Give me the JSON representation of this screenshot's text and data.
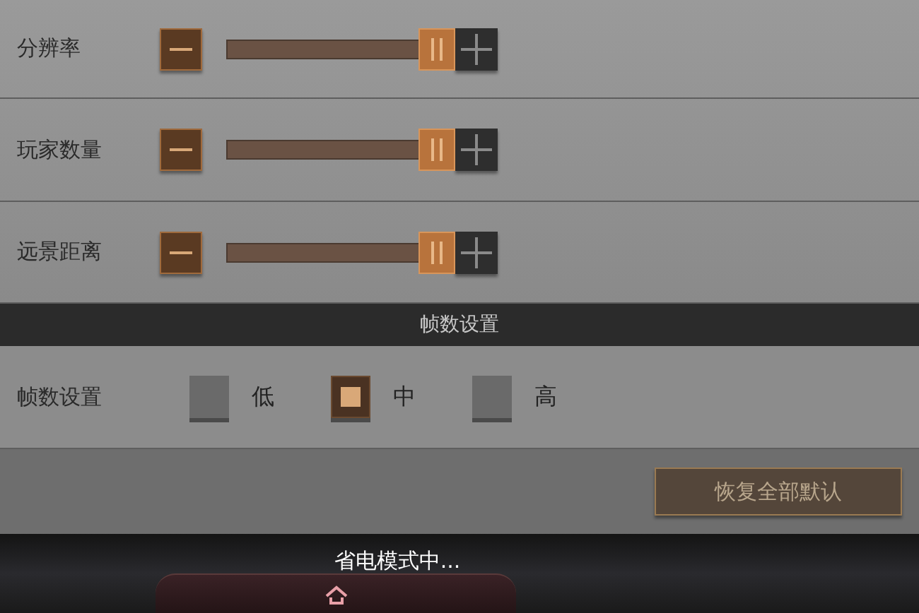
{
  "sliders": [
    {
      "label": "分辨率",
      "level": 1
    },
    {
      "label": "玩家数量",
      "level": 1
    },
    {
      "label": "远景距离",
      "level": 1
    }
  ],
  "section_header": "帧数设置",
  "frame_rate": {
    "label": "帧数设置",
    "options": [
      {
        "label": "低",
        "selected": false
      },
      {
        "label": "中",
        "selected": true
      },
      {
        "label": "高",
        "selected": false
      }
    ]
  },
  "reset_button": "恢复全部默认",
  "status_text": "省电模式中..."
}
